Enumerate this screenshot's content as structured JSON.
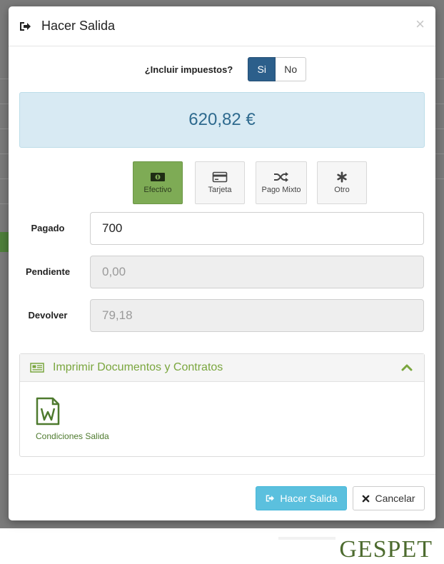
{
  "modal": {
    "title": "Hacer Salida",
    "close_symbol": "×"
  },
  "taxes": {
    "label": "¿Incluir impuestos?",
    "yes_label": "Si",
    "no_label": "No",
    "selected": "Si"
  },
  "total": "620,82 €",
  "payment_methods": [
    {
      "label": "Efectivo",
      "icon": "cash-icon",
      "active": true
    },
    {
      "label": "Tarjeta",
      "icon": "credit-card-icon",
      "active": false
    },
    {
      "label": "Pago Mixto",
      "icon": "shuffle-icon",
      "active": false
    },
    {
      "label": "Otro",
      "icon": "asterisk-icon",
      "active": false
    }
  ],
  "fields": {
    "pagado": {
      "label": "Pagado",
      "value": "700"
    },
    "pendiente": {
      "label": "Pendiente",
      "value": "0,00"
    },
    "devolver": {
      "label": "Devolver",
      "value": "79,18"
    }
  },
  "documents_panel": {
    "title": "Imprimir Documentos y Contratos",
    "items": [
      {
        "label": "Condiciones Salida",
        "icon": "word-document-icon"
      }
    ]
  },
  "footer": {
    "submit_label": "Hacer Salida",
    "cancel_label": "Cancelar"
  },
  "brand": "GESPET",
  "colors": {
    "primary_dark": "#2c5f8b",
    "success_green": "#7eab55",
    "info_blue": "#5bc0de",
    "total_bg": "#d8eaf3",
    "total_text": "#2e6a8e",
    "panel_title": "#7aa63e"
  }
}
